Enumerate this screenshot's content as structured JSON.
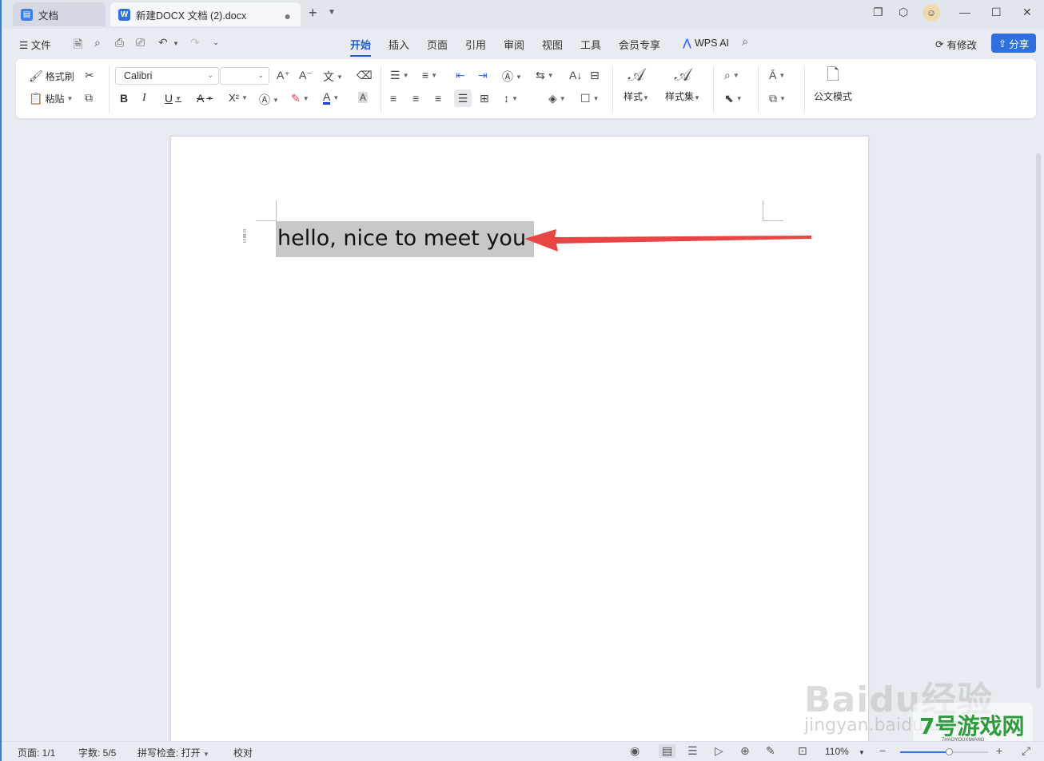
{
  "tabs": [
    {
      "label": "文档"
    },
    {
      "label": "新建DOCX 文档 (2).docx"
    }
  ],
  "menu": {
    "file_label": "文件",
    "tabs": [
      "开始",
      "插入",
      "页面",
      "引用",
      "审阅",
      "视图",
      "工具",
      "会员专享"
    ],
    "active_tab": "开始",
    "wps_ai": "WPS AI",
    "modified_label": "有修改",
    "share_label": "分享"
  },
  "ribbon": {
    "format_painter": "格式刷",
    "paste": "粘贴",
    "font_name": "Calibri",
    "font_size": "",
    "styles": "样式",
    "style_set": "样式集",
    "official_mode": "公文模式",
    "bold": "B",
    "italic": "I",
    "underline": "U",
    "strike": "A",
    "superscript": "X²",
    "font_color_sample": "A",
    "char_shading_sample": "A"
  },
  "document": {
    "selected_text": "hello, nice to meet you"
  },
  "status": {
    "page": "页面: 1/1",
    "words": "字数: 5/5",
    "spell": "拼写检查: 打开",
    "proof": "校对",
    "zoom": "110%",
    "zoom_level": 0.55
  },
  "watermark": {
    "baidu": "Baidu经验",
    "url": "jingyan.baidu.com",
    "site": "7号游戏网",
    "site_sub": "7HAOYOUXIWANG"
  },
  "colors": {
    "accent": "#2f6fe0",
    "selection": "#c8c8c8",
    "arrow": "#e84545"
  }
}
